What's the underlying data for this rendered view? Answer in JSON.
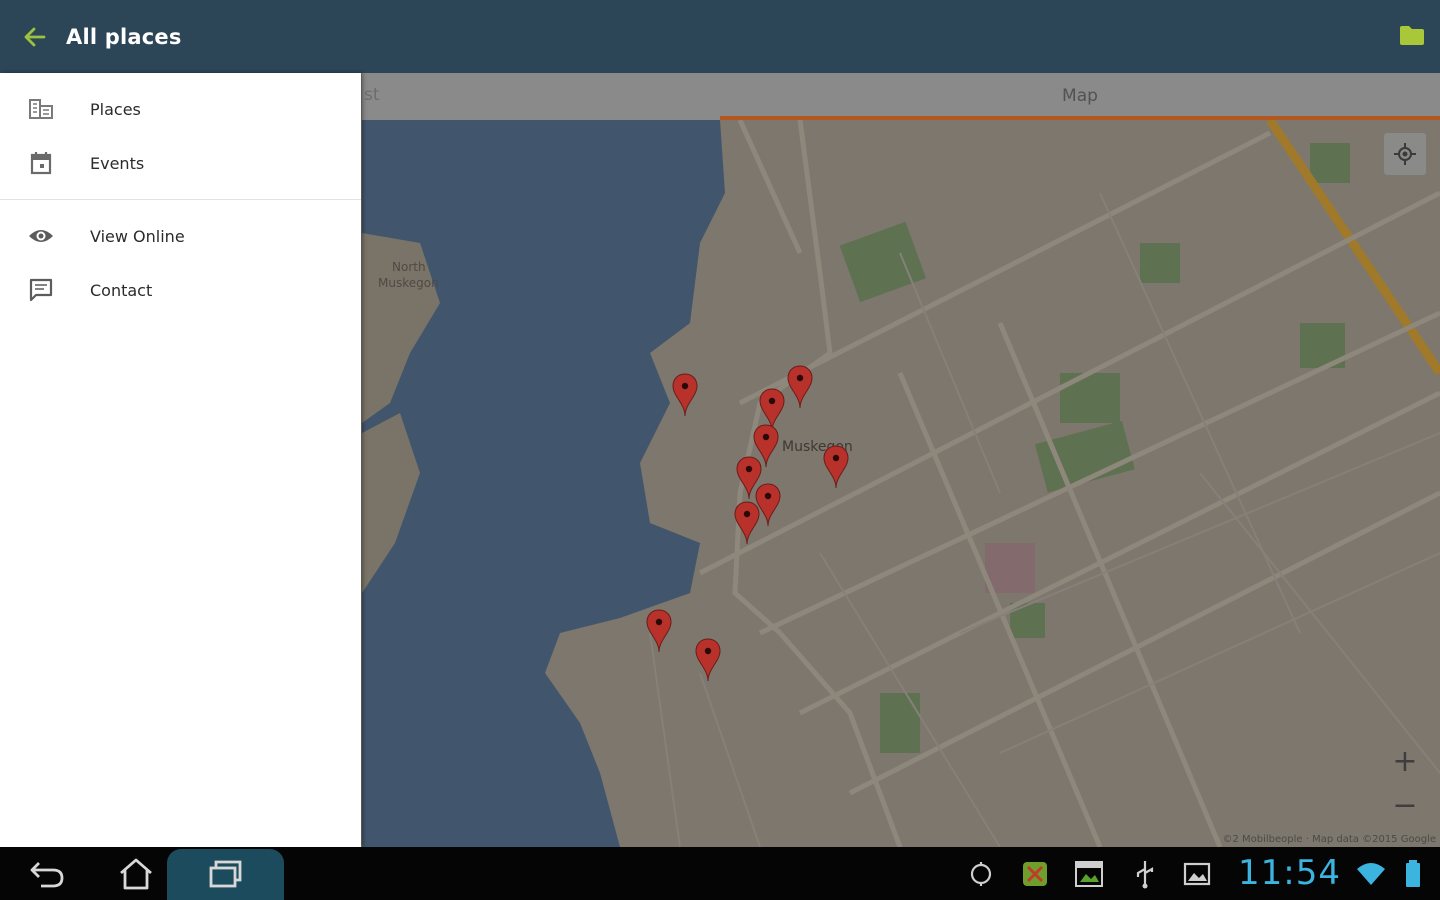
{
  "appbar": {
    "title": "All places",
    "accent": "#9cc23f",
    "background": "#2c4557"
  },
  "tabs": {
    "left_partial": "st",
    "map": "Map"
  },
  "drawer": {
    "group1": [
      {
        "label": "Places",
        "icon": "building-icon"
      },
      {
        "label": "Events",
        "icon": "calendar-icon"
      }
    ],
    "group2": [
      {
        "label": "View Online",
        "icon": "eye-icon"
      },
      {
        "label": "Contact",
        "icon": "message-icon"
      }
    ]
  },
  "map": {
    "labels": {
      "north": "North",
      "muskegon_n": "Muskegon",
      "city": "Muskegon"
    },
    "zoom_in": "+",
    "zoom_out": "−",
    "attribution": "©2 Mobilbeople · Map data ©2015 Google",
    "marker_color": "#b8312b",
    "marker_count": 11
  },
  "status": {
    "time": "11:54"
  }
}
